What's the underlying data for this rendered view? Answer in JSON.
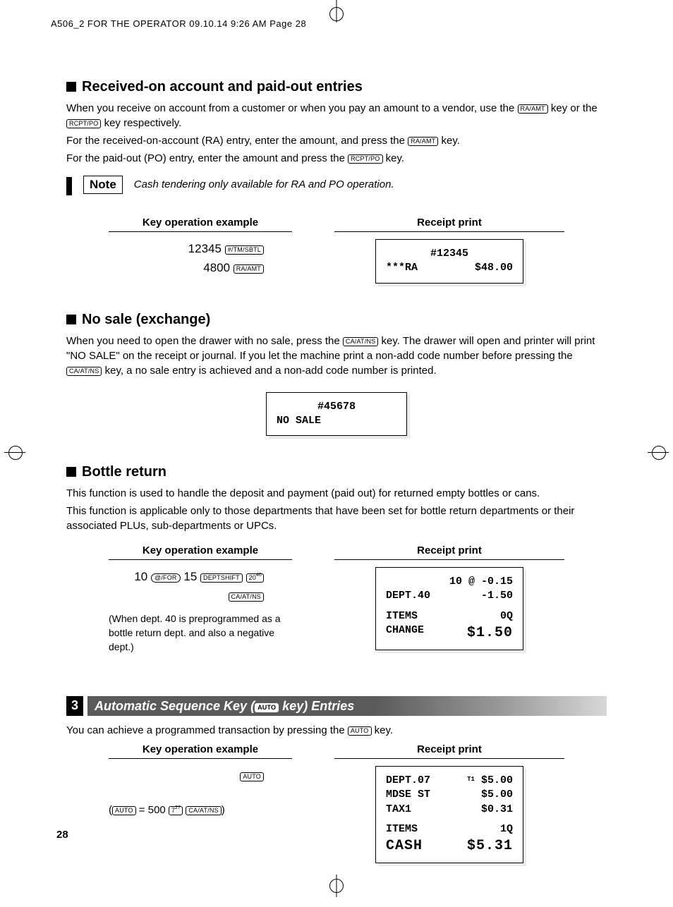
{
  "header": "A506_2 FOR THE OPERATOR  09.10.14 9:26 AM  Page 28",
  "page_number": "28",
  "keys": {
    "raamt": "RA/AMT",
    "rcptpo": "RCPT/PO",
    "tmsbtl": "#/TM/SBTL",
    "caatns": "CA/AT/NS",
    "for": "@/FOR",
    "deptshift": "DEPTSHIFT",
    "dept20": "20",
    "dept20sup": "40",
    "auto": "AUTO",
    "key7": "7",
    "key7sup": "27"
  },
  "labels": {
    "key_op": "Key operation example",
    "receipt": "Receipt print",
    "note": "Note"
  },
  "s1": {
    "heading": "Received-on account and paid-out entries",
    "p1a": "When you receive on account from a customer or when you pay an amount to a vendor, use the ",
    "p1b": " key or the ",
    "p1c": " key respectively.",
    "p2a": "For the received-on-account (RA) entry, enter the amount, and press the ",
    "p2b": " key.",
    "p3a": "For the paid-out (PO) entry, enter the amount and press the ",
    "p3b": " key.",
    "note": "Cash tendering only available for RA and PO operation.",
    "op_line1_num": "12345",
    "op_line2_num": "4800",
    "receipt": {
      "l1": "#12345",
      "l2_left": "***RA",
      "l2_right": "$48.00"
    }
  },
  "s2": {
    "heading": "No sale (exchange)",
    "p1a": "When you need to open the drawer with no sale, press the ",
    "p1b": " key.  The drawer will open and printer will print \"NO SALE\" on the receipt or journal.  If you let the machine print a non-add code number before pressing the ",
    "p1c": " key, a no sale entry is achieved and a non-add code number is printed.",
    "receipt": {
      "l1": "#45678",
      "l2": "NO SALE"
    }
  },
  "s3": {
    "heading": "Bottle return",
    "p1": "This function is used to handle the deposit and payment (paid out) for returned empty bottles or cans.",
    "p2": "This function is applicable only to those departments that have been set for bottle return departments or their associated PLUs, sub-departments or UPCs.",
    "op_pre10": "10",
    "op_mid15": "15",
    "subnote": "(When dept. 40 is preprogrammed as a bottle return dept. and also a negative dept.)",
    "receipt": {
      "r1_right": "10 @ -0.15",
      "r2_left": "DEPT.40",
      "r2_right": "-1.50",
      "r3_left": "ITEMS",
      "r3_right": "0Q",
      "r4_left": "CHANGE",
      "r4_right": "$1.50"
    }
  },
  "s4": {
    "num": "3",
    "heading_a": "Automatic Sequence Key (",
    "heading_b": " key) Entries",
    "p1a": "You can achieve a programmed transaction by pressing the ",
    "p1b": " key.",
    "op_line2_pre": "(",
    "op_line2_mid": " = 500 ",
    "op_line2_post": ")",
    "receipt": {
      "r1_left": "DEPT.07",
      "r1_right_prefix": "T1",
      "r1_right": "$5.00",
      "r2_left": "MDSE ST",
      "r2_right": "$5.00",
      "r3_left": "TAX1",
      "r3_right": "$0.31",
      "r4_left": "ITEMS",
      "r4_right": "1Q",
      "r5_left": "CASH",
      "r5_right": "$5.31"
    }
  }
}
